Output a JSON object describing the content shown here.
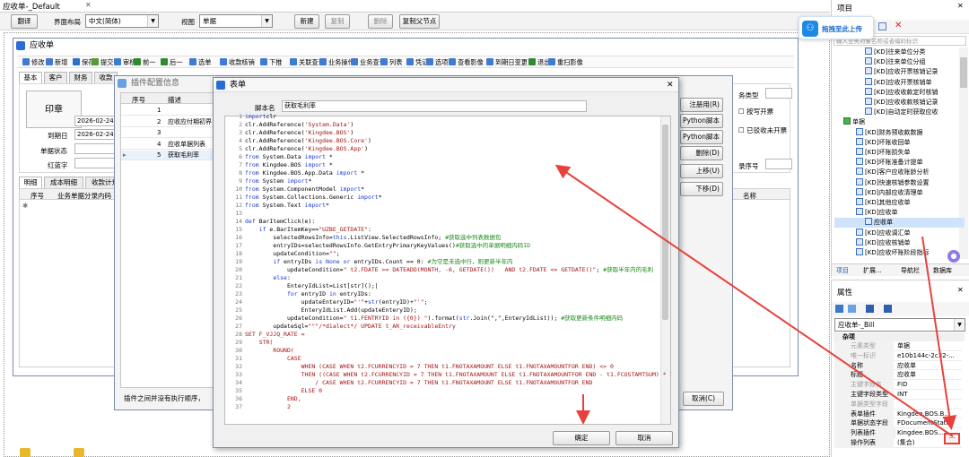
{
  "app": {
    "title": "应收单-_Default",
    "close": "✕"
  },
  "main_toolbar": {
    "translate": "翻译",
    "layout_label": "界面布局",
    "layout_value": "中文(简体)",
    "view_label": "视图",
    "view_value": "单据",
    "new": "新建",
    "copy": "复制",
    "delete": "删除",
    "copy_parent": "复制父节点"
  },
  "bill": {
    "title": "应收单",
    "toolbar": [
      "修改",
      "新增",
      "保存",
      "提交",
      "审核",
      "前一",
      "后一",
      "选单",
      "收款核销",
      "下推",
      "关联查询",
      "业务操作",
      "业务查询",
      "列表",
      "凭证",
      "选项",
      "查看影像",
      "到期日变更",
      "退出",
      "重扫影像"
    ],
    "tabs": [
      "基本",
      "客户",
      "财务",
      "收款"
    ],
    "stamp": "印章",
    "date1": "2026-02-24",
    "date2": "2026-02-24",
    "due_label": "到期日",
    "status_label": "单据状态",
    "red_label": "红蓝字",
    "bottom_tabs": [
      "明细",
      "成本明细",
      "收款计划"
    ],
    "grid_headers": [
      "序号",
      "业务单据分录内码"
    ],
    "right_field1": "务类型",
    "right_chk1": "按写开票",
    "right_chk2": "已驳收未开票",
    "right_field2": "录序号",
    "right_hdr": "名称"
  },
  "plugin": {
    "title": "插件配置信息",
    "headers": [
      "序号",
      "描述"
    ],
    "rows": [
      {
        "no": "1",
        "desc": ""
      },
      {
        "no": "2",
        "desc": "应收应付期初界"
      },
      {
        "no": "3",
        "desc": ""
      },
      {
        "no": "4",
        "desc": "应收单据列表"
      },
      {
        "no": "5",
        "desc": "获取毛利率"
      }
    ],
    "side_buttons": [
      "注册用(R)",
      "Python脚本",
      "Python脚本",
      "删除(D)",
      "上移(U)",
      "下移(D)"
    ],
    "footer": "插件之间并没有执行顺序，",
    "cancel": "取消(C)"
  },
  "form": {
    "title": "表单",
    "script_name_label": "脚本名",
    "script_name_value": "获取毛利率",
    "ok": "确定",
    "cancel": "取消",
    "close": "✕",
    "code": [
      [
        [
          "kw",
          "import"
        ],
        [
          "",
          "clr"
        ]
      ],
      [
        [
          "",
          "clr.AddReference("
        ],
        [
          "st",
          "'System.Data'"
        ],
        [
          "",
          ")"
        ]
      ],
      [
        [
          "",
          "clr.AddReference("
        ],
        [
          "st",
          "'Kingdee.BOS'"
        ],
        [
          "",
          ")"
        ]
      ],
      [
        [
          "",
          "clr.AddReference("
        ],
        [
          "st",
          "'Kingdee.BOS.Core'"
        ],
        [
          "",
          ")"
        ]
      ],
      [
        [
          "",
          "clr.AddReference("
        ],
        [
          "st",
          "'Kingdee.BOS.App'"
        ],
        [
          "",
          ")"
        ]
      ],
      [
        [
          "kw",
          "from"
        ],
        [
          "",
          " System.Data "
        ],
        [
          "kw",
          "import"
        ],
        [
          "",
          " *"
        ]
      ],
      [
        [
          "kw",
          "from"
        ],
        [
          "",
          " Kingdee.BOS "
        ],
        [
          "kw",
          "import"
        ],
        [
          "",
          " *"
        ]
      ],
      [
        [
          "kw",
          "from"
        ],
        [
          "",
          " Kingdee.BOS.App.Data "
        ],
        [
          "kw",
          "import"
        ],
        [
          "",
          " *"
        ]
      ],
      [
        [
          "kw",
          "from"
        ],
        [
          "",
          " System "
        ],
        [
          "kw",
          "import"
        ],
        [
          "",
          "*"
        ]
      ],
      [
        [
          "kw",
          "from"
        ],
        [
          "",
          " System.ComponentModel "
        ],
        [
          "kw",
          "import"
        ],
        [
          "",
          "*"
        ]
      ],
      [
        [
          "kw",
          "from"
        ],
        [
          "",
          " System.Collections.Generic "
        ],
        [
          "kw",
          "import"
        ],
        [
          "",
          "*"
        ]
      ],
      [
        [
          "kw",
          "from"
        ],
        [
          "",
          " System.Text "
        ],
        [
          "kw",
          "import"
        ],
        [
          "",
          "*"
        ]
      ],
      [
        [
          "",
          ""
        ]
      ],
      [
        [
          "kw",
          "def"
        ],
        [
          "",
          " BarItemClick(e):"
        ]
      ],
      [
        [
          "",
          "    "
        ],
        [
          "kw",
          "if"
        ],
        [
          "",
          " e.BarItemKey=="
        ],
        [
          "st",
          "\"UZBE_GETDATE\""
        ],
        [
          "",
          ":"
        ]
      ],
      [
        [
          "",
          "        selectedRowsInfo="
        ],
        [
          "kw",
          "this"
        ],
        [
          "",
          ".ListView.SelectedRowsInfo; "
        ],
        [
          "cm",
          "#获取选中列表数据包"
        ]
      ],
      [
        [
          "",
          "        entryIDs=selectedRowsInfo.GetEntryPrimaryKeyValues()"
        ],
        [
          "cm",
          "#获取选中的单据明细内码ID"
        ]
      ],
      [
        [
          "",
          "        updateCondition="
        ],
        [
          "st",
          "\"\""
        ],
        [
          "",
          ";"
        ]
      ],
      [
        [
          "",
          "        "
        ],
        [
          "kw",
          "if"
        ],
        [
          "",
          " entryIDs "
        ],
        [
          "kw",
          "is"
        ],
        [
          "",
          " "
        ],
        [
          "kw",
          "None"
        ],
        [
          "",
          " "
        ],
        [
          "kw",
          "or"
        ],
        [
          "",
          " entryIDs.Count == 0: "
        ],
        [
          "cm",
          "#为空是未选中行，则更新半年内"
        ]
      ],
      [
        [
          "",
          "            updateCondition="
        ],
        [
          "st",
          "\" t2.FDATE >= DATEADD(MONTH, -6, GETDATE())   AND t2.FDATE <= GETDATE()\""
        ],
        [
          "",
          "; "
        ],
        [
          "cm",
          "#获取半年内的毛利"
        ]
      ],
      [
        [
          "",
          "        "
        ],
        [
          "kw",
          "else"
        ],
        [
          "",
          ":"
        ]
      ],
      [
        [
          "",
          "            EnteryIdList=List[str]();|"
        ]
      ],
      [
        [
          "",
          "            "
        ],
        [
          "kw",
          "for"
        ],
        [
          "",
          " entryID "
        ],
        [
          "kw",
          "in"
        ],
        [
          "",
          " entryIDs:"
        ]
      ],
      [
        [
          "",
          "                updateEnteryID="
        ],
        [
          "st",
          "\"'\""
        ],
        [
          "",
          "+"
        ],
        [
          "kw",
          "str"
        ],
        [
          "",
          "(entryID)+"
        ],
        [
          "st",
          "\"'\""
        ],
        [
          "",
          ";"
        ]
      ],
      [
        [
          "",
          "                EnteryIdList.Add(updateEnteryID);"
        ]
      ],
      [
        [
          "",
          "            updateCondition="
        ],
        [
          "st",
          "\" t1.FENTRYID in ({0}) \""
        ],
        [
          "",
          ").format("
        ],
        [
          "kw",
          "str"
        ],
        [
          "",
          ".Join(\",\",EnteryIdList)); "
        ],
        [
          "cm",
          "#获取更新条件明细内码"
        ]
      ],
      [
        [
          "",
          "        updateSql="
        ],
        [
          "st",
          "\"\"\"/*dialect*/ UPDATE t_AR_receivableEntry"
        ]
      ],
      [
        [
          "st",
          "SET F_VJJQ_RATE ="
        ]
      ],
      [
        [
          "st",
          "    STR("
        ]
      ],
      [
        [
          "st",
          "        ROUND("
        ]
      ],
      [
        [
          "st",
          "            CASE"
        ]
      ],
      [
        [
          "st",
          "                WHEN (CASE WHEN t2.FCURRENCYID = 7 THEN t1.FNOTAXAMOUNT ELSE t1.FNOTAXAMOUNTFOR END) <> 0"
        ]
      ],
      [
        [
          "st",
          "                THEN ((CASE WHEN t2.FCURRENCYID = 7 THEN t1.FNOTAXAMOUNT ELSE t1.FNOTAXAMOUNTFOR END - t1.FCOSTAMTSUM) * 100.0)"
        ]
      ],
      [
        [
          "st",
          "                    / CASE WHEN t2.FCURRENCYID = 7 THEN t1.FNOTAXAMOUNT ELSE t1.FNOTAXAMOUNTFOR END"
        ]
      ],
      [
        [
          "st",
          "                ELSE 0"
        ]
      ],
      [
        [
          "st",
          "            END,"
        ]
      ],
      [
        [
          "st",
          "            2"
        ]
      ]
    ]
  },
  "project": {
    "title": "项目",
    "drag_upload": "拖拽至此上传",
    "search_placeholder": "输入业务对象名称或者编码标识",
    "tree": [
      {
        "t": "[KD]往来单位分类",
        "lv": 3
      },
      {
        "t": "[KD]往来单位分组",
        "lv": 3
      },
      {
        "t": "[KD]应收开票核销记录",
        "lv": 3
      },
      {
        "t": "[KD]应收开票核销单",
        "lv": 3
      },
      {
        "t": "[KD]应收收款定时核销",
        "lv": 3
      },
      {
        "t": "[KD]应收收款核销记录",
        "lv": 3
      },
      {
        "t": "[KD]自动定时获取应收",
        "lv": 3
      },
      {
        "t": "单据",
        "lv": 1,
        "folder": true
      },
      {
        "t": "[KD]财务预收款数据",
        "lv": 2
      },
      {
        "t": "[KD]坏账收回单",
        "lv": 2
      },
      {
        "t": "[KD]坏账损失单",
        "lv": 2
      },
      {
        "t": "[KD]坏账准备计提单",
        "lv": 2
      },
      {
        "t": "[KD]客户应收账龄分析",
        "lv": 2
      },
      {
        "t": "[KD]快速核销参数设置",
        "lv": 2
      },
      {
        "t": "[KD]内部应收清理单",
        "lv": 2
      },
      {
        "t": "[KD]其他应收单",
        "lv": 2
      },
      {
        "t": "[KD]应收单",
        "lv": 2
      },
      {
        "t": "应收单",
        "lv": 3,
        "sel": true
      },
      {
        "t": "[KD]应收调汇单",
        "lv": 2
      },
      {
        "t": "[KD]应收核销单",
        "lv": 2
      },
      {
        "t": "[KD]应收坏账阶段指标",
        "lv": 2
      }
    ],
    "tabs": [
      "项目",
      "扩展...",
      "导航栏",
      "数据库"
    ]
  },
  "props": {
    "title": "属性",
    "selector": "应收单-_Bill",
    "group": "杂项",
    "rows": [
      {
        "k": "元素类型",
        "v": "单据",
        "dim": true
      },
      {
        "k": "唯一标识",
        "v": "e10b144c-2c32-...",
        "dim": true
      },
      {
        "k": "名称",
        "v": "应收单"
      },
      {
        "k": "标题",
        "v": "应收单"
      },
      {
        "k": "主键字段名",
        "v": "FID",
        "dim": true
      },
      {
        "k": "主键字段类型",
        "v": "INT"
      },
      {
        "k": "单据类型字段",
        "v": "",
        "dim": true
      },
      {
        "k": "表单插件",
        "v": "Kingdee.BOS.B..."
      },
      {
        "k": "单据状态字段",
        "v": "FDocumentStatus"
      },
      {
        "k": "列表插件",
        "v": "Kingdee.BOS...",
        "hl": true
      },
      {
        "k": "操作列表",
        "v": "(集合)"
      }
    ]
  },
  "colors": {
    "accent": "#2a6cd4",
    "arrow": "#e8413c",
    "highlight": "#e8413c"
  }
}
